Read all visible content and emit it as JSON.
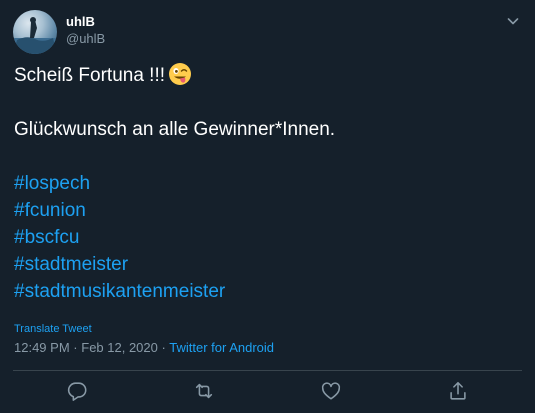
{
  "author": {
    "display_name": "uhlB",
    "handle": "@uhlB"
  },
  "tweet": {
    "line1": "Scheiß Fortuna !!!",
    "emoji": "winking-face-with-tongue",
    "line2": "Glückwunsch an alle Gewinner*Innen.",
    "hashtags": [
      "#lospech",
      "#fcunion",
      "#bscfcu",
      "#stadtmeister",
      "#stadtmusikantenmeister"
    ]
  },
  "translate_label": "Translate Tweet",
  "meta": {
    "time": "12:49 PM",
    "sep1": "·",
    "date": "Feb 12, 2020",
    "sep2": "·",
    "source": "Twitter for Android"
  },
  "actions": {
    "reply_icon": "reply-icon",
    "retweet_icon": "retweet-icon",
    "like_icon": "like-icon",
    "share_icon": "share-icon"
  },
  "colors": {
    "background": "#15202b",
    "link": "#1da1f2",
    "muted": "#8899a6",
    "divider": "#38444d"
  }
}
